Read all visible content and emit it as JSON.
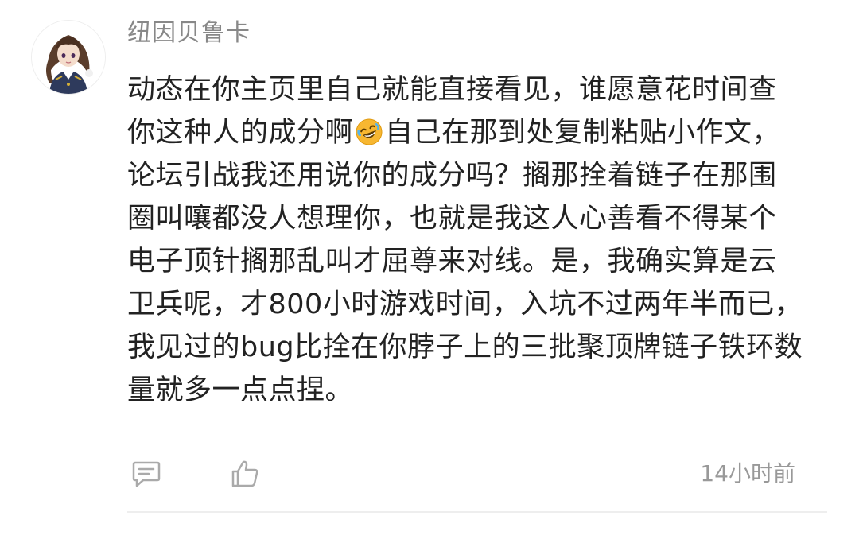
{
  "comment": {
    "username": "纽因贝鲁卡",
    "body_lines": [
      "动态在你主页里自己就能直接看见，谁愿意花时间查",
      "你这种人的成分啊",
      "自己在那到处复制粘贴小作文，",
      "论坛引战我还用说你的成分吗？搁那拴着链子在那围",
      "圈叫嚷都没人想理你，也就是我这人心善看不得某个",
      "电子顶针搁那乱叫才屈尊来对线。是，我确实算是云",
      "卫兵呢，才800小时游戏时间，入坑不过两年半而已，",
      "我见过的bug比拴在你脖子上的三批聚顶牌链子铁环数",
      "量就多一点点捏。"
    ],
    "inline_emoji": "rofl-face-icon",
    "timestamp": "14小时前",
    "actions": {
      "reply_icon": "comment-icon",
      "like_icon": "thumbs-up-icon"
    }
  },
  "colors": {
    "username": "#888888",
    "body_text": "#222222",
    "icons": "#aaaaaa",
    "timestamp": "#999999",
    "divider": "#eeeeee",
    "emoji_face": "#f7b731"
  }
}
